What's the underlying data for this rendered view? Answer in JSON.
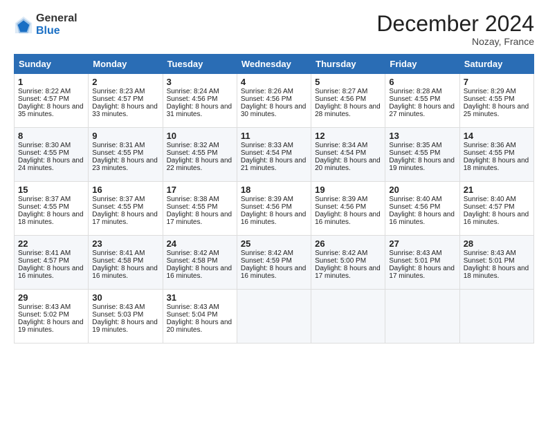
{
  "logo": {
    "general": "General",
    "blue": "Blue"
  },
  "title": "December 2024",
  "location": "Nozay, France",
  "days_header": [
    "Sunday",
    "Monday",
    "Tuesday",
    "Wednesday",
    "Thursday",
    "Friday",
    "Saturday"
  ],
  "weeks": [
    [
      {
        "day": "1",
        "sunrise": "Sunrise: 8:22 AM",
        "sunset": "Sunset: 4:57 PM",
        "daylight": "Daylight: 8 hours and 35 minutes."
      },
      {
        "day": "2",
        "sunrise": "Sunrise: 8:23 AM",
        "sunset": "Sunset: 4:57 PM",
        "daylight": "Daylight: 8 hours and 33 minutes."
      },
      {
        "day": "3",
        "sunrise": "Sunrise: 8:24 AM",
        "sunset": "Sunset: 4:56 PM",
        "daylight": "Daylight: 8 hours and 31 minutes."
      },
      {
        "day": "4",
        "sunrise": "Sunrise: 8:26 AM",
        "sunset": "Sunset: 4:56 PM",
        "daylight": "Daylight: 8 hours and 30 minutes."
      },
      {
        "day": "5",
        "sunrise": "Sunrise: 8:27 AM",
        "sunset": "Sunset: 4:56 PM",
        "daylight": "Daylight: 8 hours and 28 minutes."
      },
      {
        "day": "6",
        "sunrise": "Sunrise: 8:28 AM",
        "sunset": "Sunset: 4:55 PM",
        "daylight": "Daylight: 8 hours and 27 minutes."
      },
      {
        "day": "7",
        "sunrise": "Sunrise: 8:29 AM",
        "sunset": "Sunset: 4:55 PM",
        "daylight": "Daylight: 8 hours and 25 minutes."
      }
    ],
    [
      {
        "day": "8",
        "sunrise": "Sunrise: 8:30 AM",
        "sunset": "Sunset: 4:55 PM",
        "daylight": "Daylight: 8 hours and 24 minutes."
      },
      {
        "day": "9",
        "sunrise": "Sunrise: 8:31 AM",
        "sunset": "Sunset: 4:55 PM",
        "daylight": "Daylight: 8 hours and 23 minutes."
      },
      {
        "day": "10",
        "sunrise": "Sunrise: 8:32 AM",
        "sunset": "Sunset: 4:55 PM",
        "daylight": "Daylight: 8 hours and 22 minutes."
      },
      {
        "day": "11",
        "sunrise": "Sunrise: 8:33 AM",
        "sunset": "Sunset: 4:54 PM",
        "daylight": "Daylight: 8 hours and 21 minutes."
      },
      {
        "day": "12",
        "sunrise": "Sunrise: 8:34 AM",
        "sunset": "Sunset: 4:54 PM",
        "daylight": "Daylight: 8 hours and 20 minutes."
      },
      {
        "day": "13",
        "sunrise": "Sunrise: 8:35 AM",
        "sunset": "Sunset: 4:55 PM",
        "daylight": "Daylight: 8 hours and 19 minutes."
      },
      {
        "day": "14",
        "sunrise": "Sunrise: 8:36 AM",
        "sunset": "Sunset: 4:55 PM",
        "daylight": "Daylight: 8 hours and 18 minutes."
      }
    ],
    [
      {
        "day": "15",
        "sunrise": "Sunrise: 8:37 AM",
        "sunset": "Sunset: 4:55 PM",
        "daylight": "Daylight: 8 hours and 18 minutes."
      },
      {
        "day": "16",
        "sunrise": "Sunrise: 8:37 AM",
        "sunset": "Sunset: 4:55 PM",
        "daylight": "Daylight: 8 hours and 17 minutes."
      },
      {
        "day": "17",
        "sunrise": "Sunrise: 8:38 AM",
        "sunset": "Sunset: 4:55 PM",
        "daylight": "Daylight: 8 hours and 17 minutes."
      },
      {
        "day": "18",
        "sunrise": "Sunrise: 8:39 AM",
        "sunset": "Sunset: 4:56 PM",
        "daylight": "Daylight: 8 hours and 16 minutes."
      },
      {
        "day": "19",
        "sunrise": "Sunrise: 8:39 AM",
        "sunset": "Sunset: 4:56 PM",
        "daylight": "Daylight: 8 hours and 16 minutes."
      },
      {
        "day": "20",
        "sunrise": "Sunrise: 8:40 AM",
        "sunset": "Sunset: 4:56 PM",
        "daylight": "Daylight: 8 hours and 16 minutes."
      },
      {
        "day": "21",
        "sunrise": "Sunrise: 8:40 AM",
        "sunset": "Sunset: 4:57 PM",
        "daylight": "Daylight: 8 hours and 16 minutes."
      }
    ],
    [
      {
        "day": "22",
        "sunrise": "Sunrise: 8:41 AM",
        "sunset": "Sunset: 4:57 PM",
        "daylight": "Daylight: 8 hours and 16 minutes."
      },
      {
        "day": "23",
        "sunrise": "Sunrise: 8:41 AM",
        "sunset": "Sunset: 4:58 PM",
        "daylight": "Daylight: 8 hours and 16 minutes."
      },
      {
        "day": "24",
        "sunrise": "Sunrise: 8:42 AM",
        "sunset": "Sunset: 4:58 PM",
        "daylight": "Daylight: 8 hours and 16 minutes."
      },
      {
        "day": "25",
        "sunrise": "Sunrise: 8:42 AM",
        "sunset": "Sunset: 4:59 PM",
        "daylight": "Daylight: 8 hours and 16 minutes."
      },
      {
        "day": "26",
        "sunrise": "Sunrise: 8:42 AM",
        "sunset": "Sunset: 5:00 PM",
        "daylight": "Daylight: 8 hours and 17 minutes."
      },
      {
        "day": "27",
        "sunrise": "Sunrise: 8:43 AM",
        "sunset": "Sunset: 5:01 PM",
        "daylight": "Daylight: 8 hours and 17 minutes."
      },
      {
        "day": "28",
        "sunrise": "Sunrise: 8:43 AM",
        "sunset": "Sunset: 5:01 PM",
        "daylight": "Daylight: 8 hours and 18 minutes."
      }
    ],
    [
      {
        "day": "29",
        "sunrise": "Sunrise: 8:43 AM",
        "sunset": "Sunset: 5:02 PM",
        "daylight": "Daylight: 8 hours and 19 minutes."
      },
      {
        "day": "30",
        "sunrise": "Sunrise: 8:43 AM",
        "sunset": "Sunset: 5:03 PM",
        "daylight": "Daylight: 8 hours and 19 minutes."
      },
      {
        "day": "31",
        "sunrise": "Sunrise: 8:43 AM",
        "sunset": "Sunset: 5:04 PM",
        "daylight": "Daylight: 8 hours and 20 minutes."
      },
      null,
      null,
      null,
      null
    ]
  ]
}
